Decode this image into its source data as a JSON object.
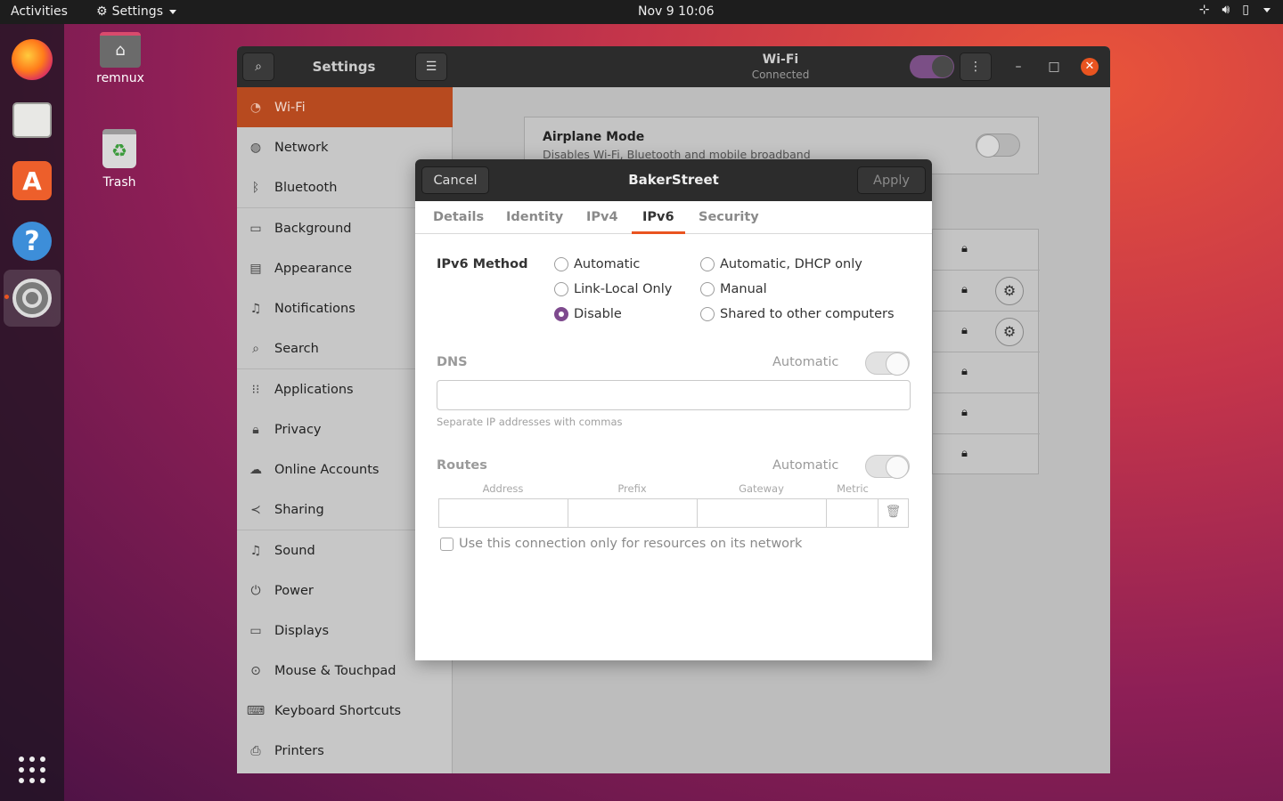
{
  "topbar": {
    "activities": "Activities",
    "app_menu": "Settings",
    "clock": "Nov 9  10:06",
    "icons": [
      "network-icon",
      "volume-icon",
      "battery-icon",
      "system-menu-icon"
    ]
  },
  "dock": {
    "items": [
      "firefox",
      "files",
      "ubuntu-software",
      "help",
      "settings"
    ]
  },
  "desktop": {
    "home_label": "remnux",
    "trash_label": "Trash"
  },
  "settings_window": {
    "title": "Settings",
    "panel_title": "Wi-Fi",
    "panel_subtitle": "Connected",
    "sidebar": [
      {
        "label": "Wi-Fi",
        "icon": "wifi-icon",
        "selected": true
      },
      {
        "label": "Network",
        "icon": "network-globe-icon"
      },
      {
        "label": "Bluetooth",
        "icon": "bluetooth-icon"
      },
      {
        "label": "Background",
        "icon": "background-icon"
      },
      {
        "label": "Appearance",
        "icon": "appearance-icon"
      },
      {
        "label": "Notifications",
        "icon": "bell-icon"
      },
      {
        "label": "Search",
        "icon": "search-icon"
      },
      {
        "label": "Applications",
        "icon": "apps-grid-icon"
      },
      {
        "label": "Privacy",
        "icon": "lock-icon"
      },
      {
        "label": "Online Accounts",
        "icon": "cloud-icon"
      },
      {
        "label": "Sharing",
        "icon": "share-icon"
      },
      {
        "label": "Sound",
        "icon": "music-note-icon"
      },
      {
        "label": "Power",
        "icon": "power-icon"
      },
      {
        "label": "Displays",
        "icon": "display-icon"
      },
      {
        "label": "Mouse & Touchpad",
        "icon": "mouse-icon"
      },
      {
        "label": "Keyboard Shortcuts",
        "icon": "keyboard-icon"
      },
      {
        "label": "Printers",
        "icon": "printer-icon"
      }
    ],
    "airplane": {
      "title": "Airplane Mode",
      "subtitle": "Disables Wi-Fi, Bluetooth and mobile broadband"
    }
  },
  "dialog": {
    "cancel": "Cancel",
    "title": "BakerStreet",
    "apply": "Apply",
    "tabs": [
      "Details",
      "Identity",
      "IPv4",
      "IPv6",
      "Security"
    ],
    "active_tab": "IPv6",
    "method_label": "IPv6 Method",
    "methods": [
      {
        "label": "Automatic",
        "selected": false
      },
      {
        "label": "Automatic, DHCP only",
        "selected": false
      },
      {
        "label": "Link-Local Only",
        "selected": false
      },
      {
        "label": "Manual",
        "selected": false
      },
      {
        "label": "Disable",
        "selected": true
      },
      {
        "label": "Shared to other computers",
        "selected": false
      }
    ],
    "dns_label": "DNS",
    "dns_auto_label": "Automatic",
    "dns_value": "",
    "dns_hint": "Separate IP addresses with commas",
    "routes_label": "Routes",
    "routes_auto_label": "Automatic",
    "route_columns": [
      "Address",
      "Prefix",
      "Gateway",
      "Metric"
    ],
    "checkbox_label": "Use this connection only for resources on its network"
  },
  "colors": {
    "accent": "#e95420",
    "radio_selected": "#7e4a8e",
    "sidebar_selected": "#b74a1f"
  }
}
